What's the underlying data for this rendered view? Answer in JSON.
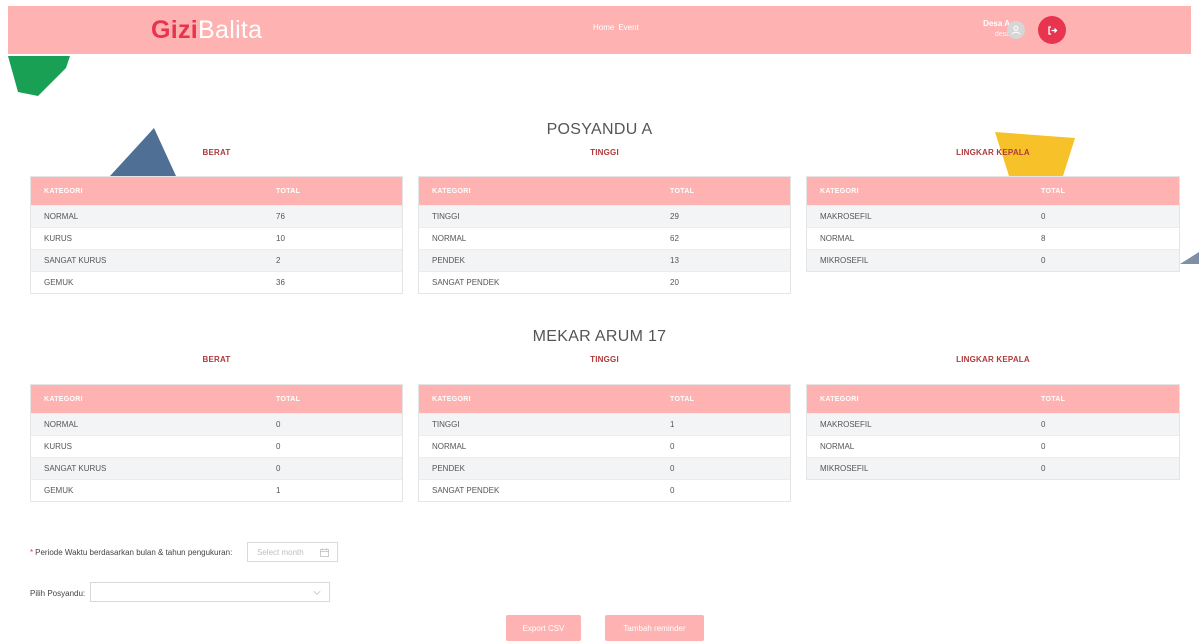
{
  "header": {
    "logo_part1": "Gizi",
    "logo_part2": "Balita",
    "nav": [
      "Home",
      "Event"
    ],
    "user_name": "Desa A",
    "user_role": "desa"
  },
  "labels": {
    "kategori": "KATEGORI",
    "total": "TOTAL",
    "berat": "BERAT",
    "tinggi": "TINGGI",
    "lingkar": "LINGKAR KEPALA"
  },
  "groups": [
    {
      "title": "POSYANDU A",
      "berat": [
        [
          "NORMAL",
          "76"
        ],
        [
          "KURUS",
          "10"
        ],
        [
          "SANGAT KURUS",
          "2"
        ],
        [
          "GEMUK",
          "36"
        ]
      ],
      "tinggi": [
        [
          "TINGGI",
          "29"
        ],
        [
          "NORMAL",
          "62"
        ],
        [
          "PENDEK",
          "13"
        ],
        [
          "SANGAT PENDEK",
          "20"
        ]
      ],
      "lingkar": [
        [
          "MAKROSEFIL",
          "0"
        ],
        [
          "NORMAL",
          "8"
        ],
        [
          "MIKROSEFIL",
          "0"
        ]
      ]
    },
    {
      "title": "MEKAR ARUM 17",
      "berat": [
        [
          "NORMAL",
          "0"
        ],
        [
          "KURUS",
          "0"
        ],
        [
          "SANGAT KURUS",
          "0"
        ],
        [
          "GEMUK",
          "1"
        ]
      ],
      "tinggi": [
        [
          "TINGGI",
          "1"
        ],
        [
          "NORMAL",
          "0"
        ],
        [
          "PENDEK",
          "0"
        ],
        [
          "SANGAT PENDEK",
          "0"
        ]
      ],
      "lingkar": [
        [
          "MAKROSEFIL",
          "0"
        ],
        [
          "NORMAL",
          "0"
        ],
        [
          "MIKROSEFIL",
          "0"
        ]
      ]
    }
  ],
  "form": {
    "periode_required": "*",
    "periode_label": "Periode Waktu berdasarkan bulan & tahun pengukuran",
    "periode_placeholder": "Select month",
    "posyandu_label": "Pilih Posyandu",
    "posyandu_value": ""
  },
  "buttons": {
    "export": "Export CSV",
    "reminder": "Tambah reminder"
  },
  "colors": {
    "header_bg": "#ffb2b2",
    "brand_red": "#e8344e"
  },
  "icons": {
    "avatar": "user-icon",
    "logout": "logout-icon",
    "calendar": "calendar-icon",
    "dropdown": "chevron-down-icon"
  }
}
